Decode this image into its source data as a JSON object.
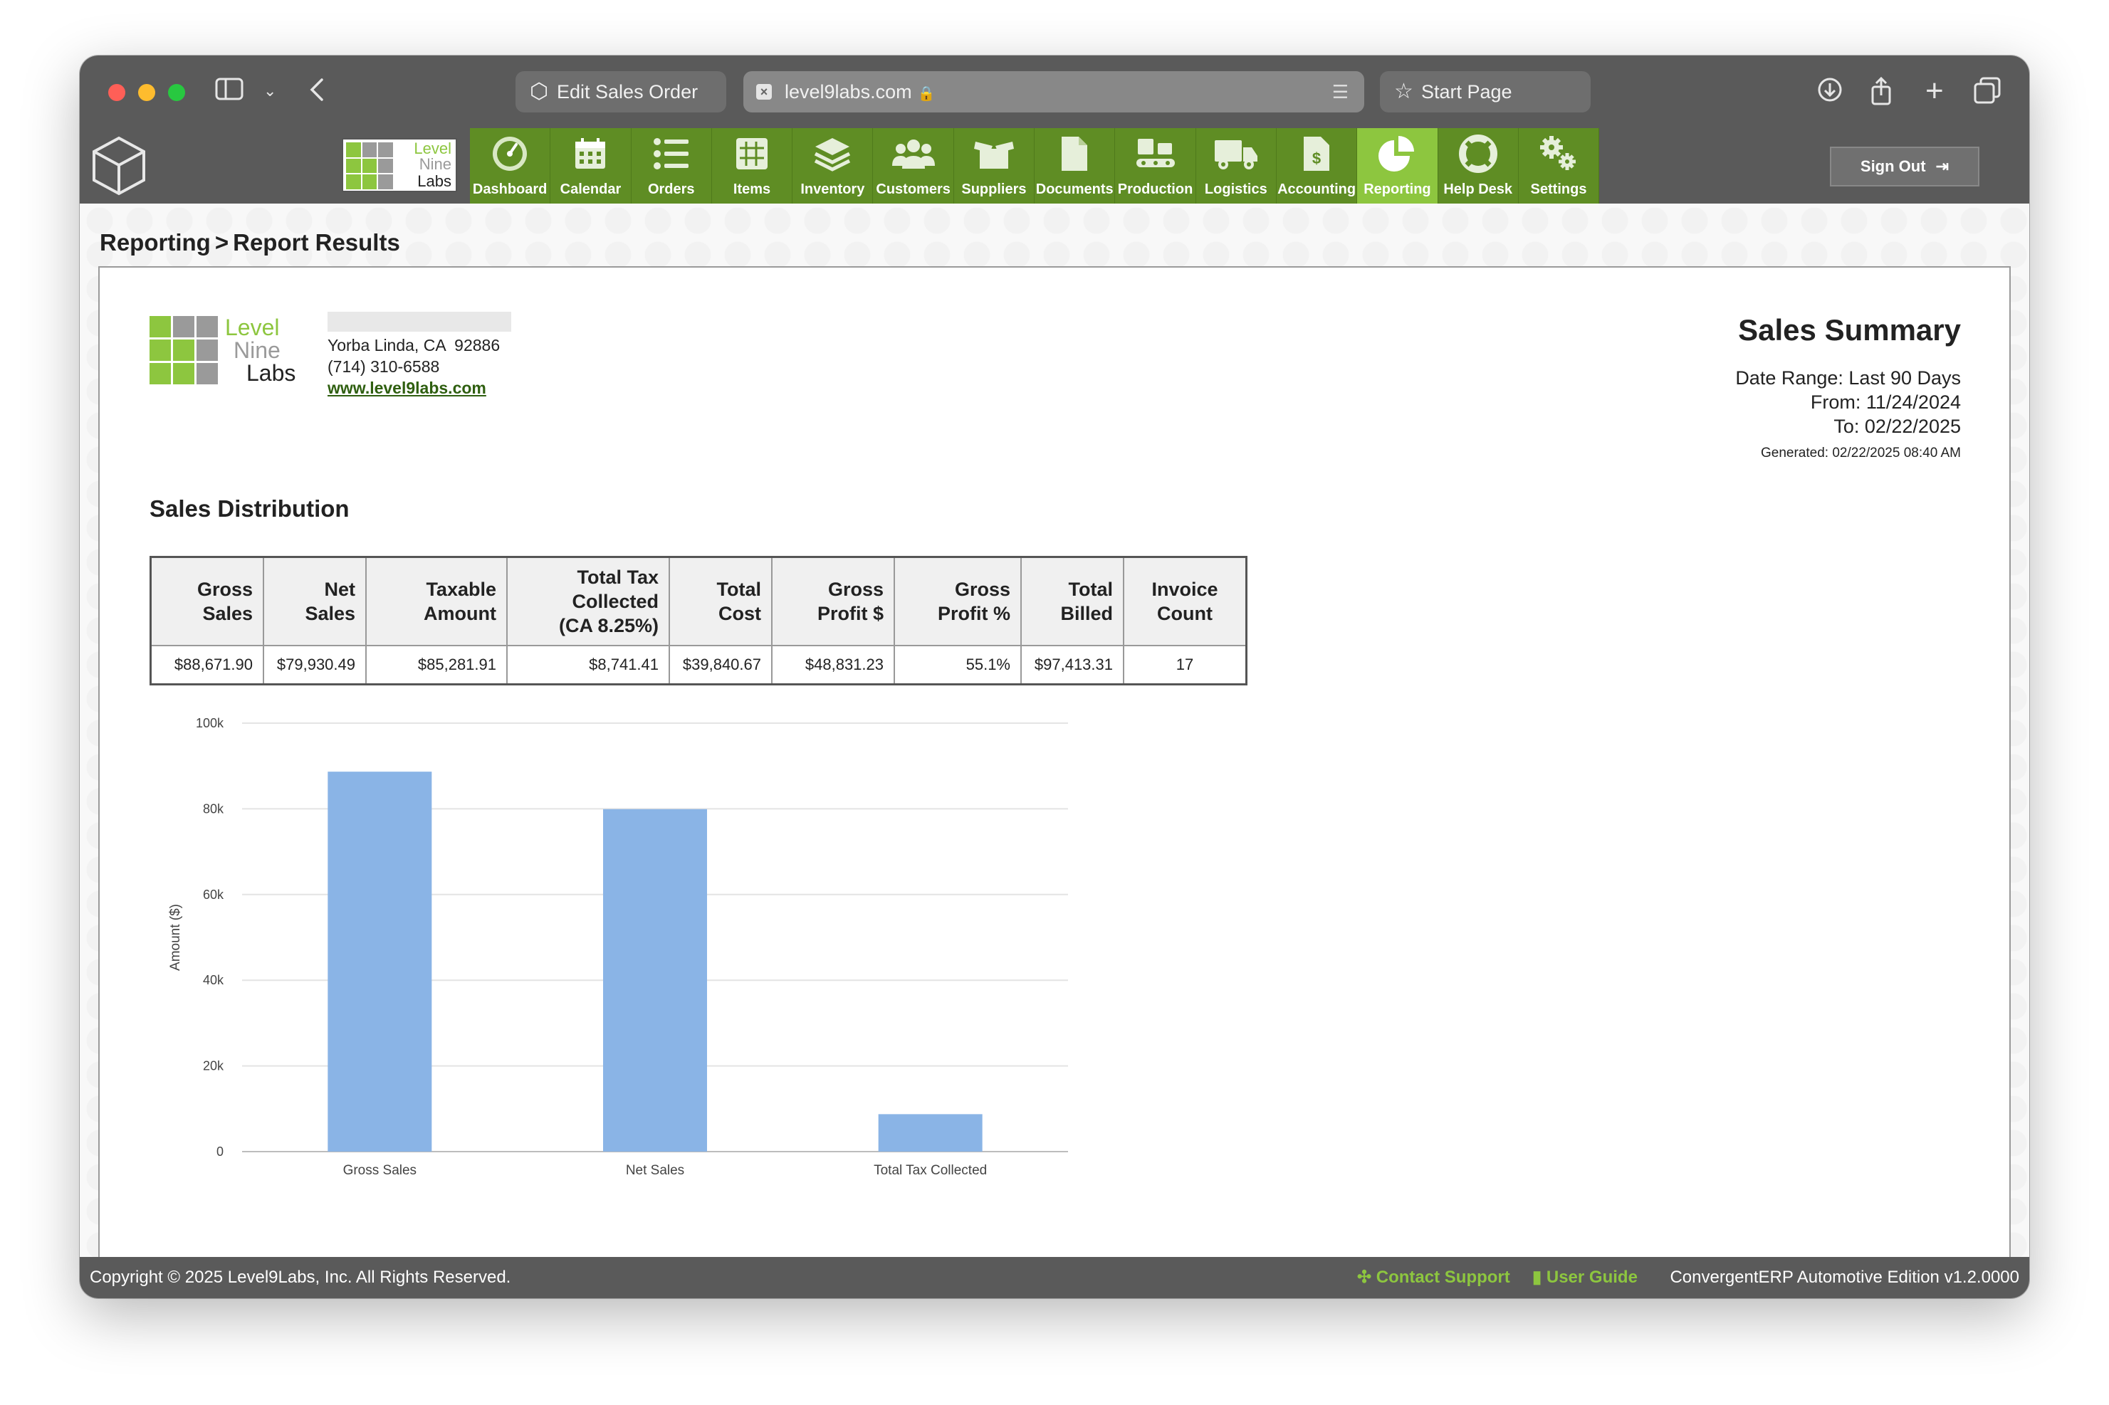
{
  "browser": {
    "tabs": [
      {
        "label": "Edit Sales Order"
      },
      {
        "label": "level9labs.com",
        "active": true
      },
      {
        "label": "Start Page"
      }
    ]
  },
  "header": {
    "brand_words": [
      "Level",
      "Nine",
      "Labs"
    ],
    "nav": [
      {
        "label": "Dashboard",
        "icon": "dashboard-gauge-icon"
      },
      {
        "label": "Calendar",
        "icon": "calendar-icon"
      },
      {
        "label": "Orders",
        "icon": "list-icon"
      },
      {
        "label": "Items",
        "icon": "grid-icon"
      },
      {
        "label": "Inventory",
        "icon": "layers-icon"
      },
      {
        "label": "Customers",
        "icon": "people-icon"
      },
      {
        "label": "Suppliers",
        "icon": "box-icon"
      },
      {
        "label": "Documents",
        "icon": "document-icon"
      },
      {
        "label": "Production",
        "icon": "conveyor-icon"
      },
      {
        "label": "Logistics",
        "icon": "truck-icon"
      },
      {
        "label": "Accounting",
        "icon": "invoice-dollar-icon"
      },
      {
        "label": "Reporting",
        "icon": "pie-chart-icon",
        "active": true
      },
      {
        "label": "Help Desk",
        "icon": "lifebuoy-icon"
      },
      {
        "label": "Settings",
        "icon": "gears-icon"
      }
    ],
    "sign_out": "Sign Out"
  },
  "breadcrumb": {
    "parent": "Reporting",
    "sep": ">",
    "current": "Report Results"
  },
  "report": {
    "company": {
      "city_line": "Yorba Linda, CA  92886",
      "phone": "(714) 310-6588",
      "website": "www.level9labs.com"
    },
    "title": "Sales Summary",
    "date_range": "Date Range: Last 90 Days",
    "from": "From: 11/24/2024",
    "to": "To: 02/22/2025",
    "generated": "Generated: 02/22/2025 08:40 AM",
    "section_title": "Sales Distribution",
    "table": {
      "headers": [
        [
          "Gross",
          "Sales"
        ],
        [
          "Net",
          "Sales"
        ],
        [
          "Taxable",
          "Amount"
        ],
        [
          "Total Tax",
          "Collected",
          "(CA 8.25%)"
        ],
        [
          "Total",
          "Cost"
        ],
        [
          "Gross",
          "Profit $"
        ],
        [
          "Gross",
          "Profit %"
        ],
        [
          "Total",
          "Billed"
        ],
        [
          "Invoice",
          "Count"
        ]
      ],
      "row": [
        "$88,671.90",
        "$79,930.49",
        "$85,281.91",
        "$8,741.41",
        "$39,840.67",
        "$48,831.23",
        "55.1%",
        "$97,413.31",
        "17"
      ]
    }
  },
  "chart_data": {
    "type": "bar",
    "categories": [
      "Gross Sales",
      "Net Sales",
      "Total Tax Collected"
    ],
    "values": [
      88671.9,
      79930.49,
      8741.41
    ],
    "ylabel": "Amount ($)",
    "xlabel": "",
    "ylim": [
      0,
      100000
    ],
    "yticks": [
      0,
      20000,
      40000,
      60000,
      80000,
      100000
    ],
    "ytick_labels": [
      "0",
      "20k",
      "40k",
      "60k",
      "80k",
      "100k"
    ],
    "grid": true,
    "bar_color": "#8ab4e6"
  },
  "footer": {
    "copyright": "Copyright © 2025 Level9Labs, Inc. All Rights Reserved.",
    "contact": "Contact Support",
    "guide": "User Guide",
    "version": "ConvergentERP Automotive Edition v1.2.0000"
  },
  "colors": {
    "nav_green": "#5f8d24",
    "nav_active": "#8dc63f",
    "chrome": "#5a5a5a"
  }
}
